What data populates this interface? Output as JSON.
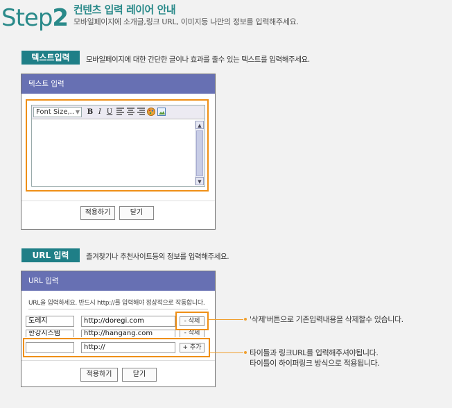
{
  "header": {
    "step_a": "Step",
    "step_b": "2",
    "title": "컨텐츠 입력 레이어 안내",
    "subtitle": "모바일페이지에 소개글,링크 URL, 이미지등 나만의 정보를 입력해주세요."
  },
  "text_section": {
    "label": "텍스트입력",
    "description": "모바일페이지에 대한 간단한 글이나 효과를 줄수 있는 텍스트를 입력해주세요.",
    "panel_title": "텍스트 입력",
    "font_select": "Font Size,..",
    "toolbar": {
      "bold": "B",
      "italic": "I",
      "underline": "U"
    },
    "apply_button": "적용하기",
    "close_button": "닫기"
  },
  "url_section": {
    "label": "URL 입력",
    "description": "즐겨찾기나 추천사이트등의 정보를 입력해주세요.",
    "panel_title": "URL 입력",
    "note": "URL을 입력하세요. 반드시 http://를 입력해야 정상적으로 작동합니다.",
    "rows": [
      {
        "title": "도레지",
        "url": "http://doregi.com",
        "button": "- 삭제"
      },
      {
        "title": "한강시스템",
        "url": "http://hangang.com",
        "button": "- 삭제"
      },
      {
        "title": "",
        "url": "http://",
        "button": "+ 추가"
      }
    ],
    "apply_button": "적용하기",
    "close_button": "닫기"
  },
  "callouts": {
    "delete": "'삭제'버튼으로 기존입력내용을 삭제할수 있습니다.",
    "add_line1": "타이틀과 링크URL를 입력해주셔야됩니다.",
    "add_line2": "타이틀이 하이퍼링크 방식으로 적용됩니다."
  },
  "colors": {
    "teal": "#1f7f87",
    "panel_header": "#6770b3",
    "highlight": "#ef8f16"
  }
}
